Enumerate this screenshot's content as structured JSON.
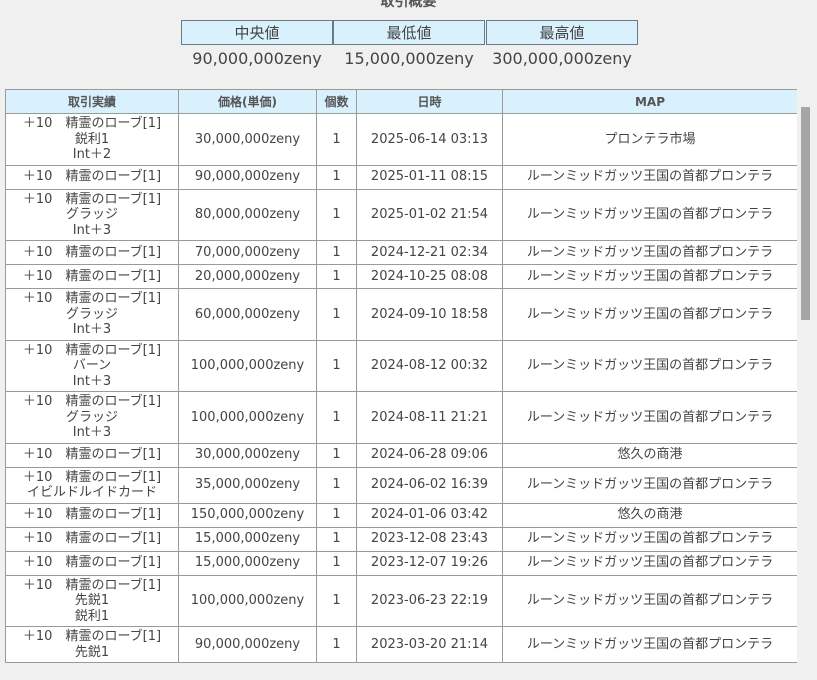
{
  "summary": {
    "title": "取引概要",
    "stats": [
      {
        "label": "中央値",
        "value": "90,000,000zeny"
      },
      {
        "label": "最低値",
        "value": "15,000,000zeny"
      },
      {
        "label": "最高値",
        "value": "300,000,000zeny"
      }
    ]
  },
  "table": {
    "headers": [
      "取引実績",
      "価格(単価)",
      "個数",
      "日時",
      "MAP"
    ],
    "rows": [
      {
        "item": [
          "＋10　精霊のローブ[1]",
          "鋭利1",
          "Int＋2"
        ],
        "price": "30,000,000zeny",
        "qty": "1",
        "date": "2025-06-14 03:13",
        "map": "プロンテラ市場"
      },
      {
        "item": [
          "＋10　精霊のローブ[1]"
        ],
        "price": "90,000,000zeny",
        "qty": "1",
        "date": "2025-01-11 08:15",
        "map": "ルーンミッドガッツ王国の首都プロンテラ"
      },
      {
        "item": [
          "＋10　精霊のローブ[1]",
          "グラッジ",
          "Int＋3"
        ],
        "price": "80,000,000zeny",
        "qty": "1",
        "date": "2025-01-02 21:54",
        "map": "ルーンミッドガッツ王国の首都プロンテラ"
      },
      {
        "item": [
          "＋10　精霊のローブ[1]"
        ],
        "price": "70,000,000zeny",
        "qty": "1",
        "date": "2024-12-21 02:34",
        "map": "ルーンミッドガッツ王国の首都プロンテラ"
      },
      {
        "item": [
          "＋10　精霊のローブ[1]"
        ],
        "price": "20,000,000zeny",
        "qty": "1",
        "date": "2024-10-25 08:08",
        "map": "ルーンミッドガッツ王国の首都プロンテラ"
      },
      {
        "item": [
          "＋10　精霊のローブ[1]",
          "グラッジ",
          "Int＋3"
        ],
        "price": "60,000,000zeny",
        "qty": "1",
        "date": "2024-09-10 18:58",
        "map": "ルーンミッドガッツ王国の首都プロンテラ"
      },
      {
        "item": [
          "＋10　精霊のローブ[1]",
          "バーン",
          "Int＋3"
        ],
        "price": "100,000,000zeny",
        "qty": "1",
        "date": "2024-08-12 00:32",
        "map": "ルーンミッドガッツ王国の首都プロンテラ"
      },
      {
        "item": [
          "＋10　精霊のローブ[1]",
          "グラッジ",
          "Int＋3"
        ],
        "price": "100,000,000zeny",
        "qty": "1",
        "date": "2024-08-11 21:21",
        "map": "ルーンミッドガッツ王国の首都プロンテラ"
      },
      {
        "item": [
          "＋10　精霊のローブ[1]"
        ],
        "price": "30,000,000zeny",
        "qty": "1",
        "date": "2024-06-28 09:06",
        "map": "悠久の商港"
      },
      {
        "item": [
          "＋10　精霊のローブ[1]",
          "イビルドルイドカード"
        ],
        "price": "35,000,000zeny",
        "qty": "1",
        "date": "2024-06-02 16:39",
        "map": "ルーンミッドガッツ王国の首都プロンテラ"
      },
      {
        "item": [
          "＋10　精霊のローブ[1]"
        ],
        "price": "150,000,000zeny",
        "qty": "1",
        "date": "2024-01-06 03:42",
        "map": "悠久の商港"
      },
      {
        "item": [
          "＋10　精霊のローブ[1]"
        ],
        "price": "15,000,000zeny",
        "qty": "1",
        "date": "2023-12-08 23:43",
        "map": "ルーンミッドガッツ王国の首都プロンテラ"
      },
      {
        "item": [
          "＋10　精霊のローブ[1]"
        ],
        "price": "15,000,000zeny",
        "qty": "1",
        "date": "2023-12-07 19:26",
        "map": "ルーンミッドガッツ王国の首都プロンテラ"
      },
      {
        "item": [
          "＋10　精霊のローブ[1]",
          "先鋭1",
          "鋭利1"
        ],
        "price": "100,000,000zeny",
        "qty": "1",
        "date": "2023-06-23 22:19",
        "map": "ルーンミッドガッツ王国の首都プロンテラ"
      },
      {
        "item": [
          "＋10　精霊のローブ[1]",
          "先鋭1"
        ],
        "price": "90,000,000zeny",
        "qty": "1",
        "date": "2023-03-20 21:14",
        "map": "ルーンミッドガッツ王国の首都プロンテラ"
      }
    ]
  }
}
